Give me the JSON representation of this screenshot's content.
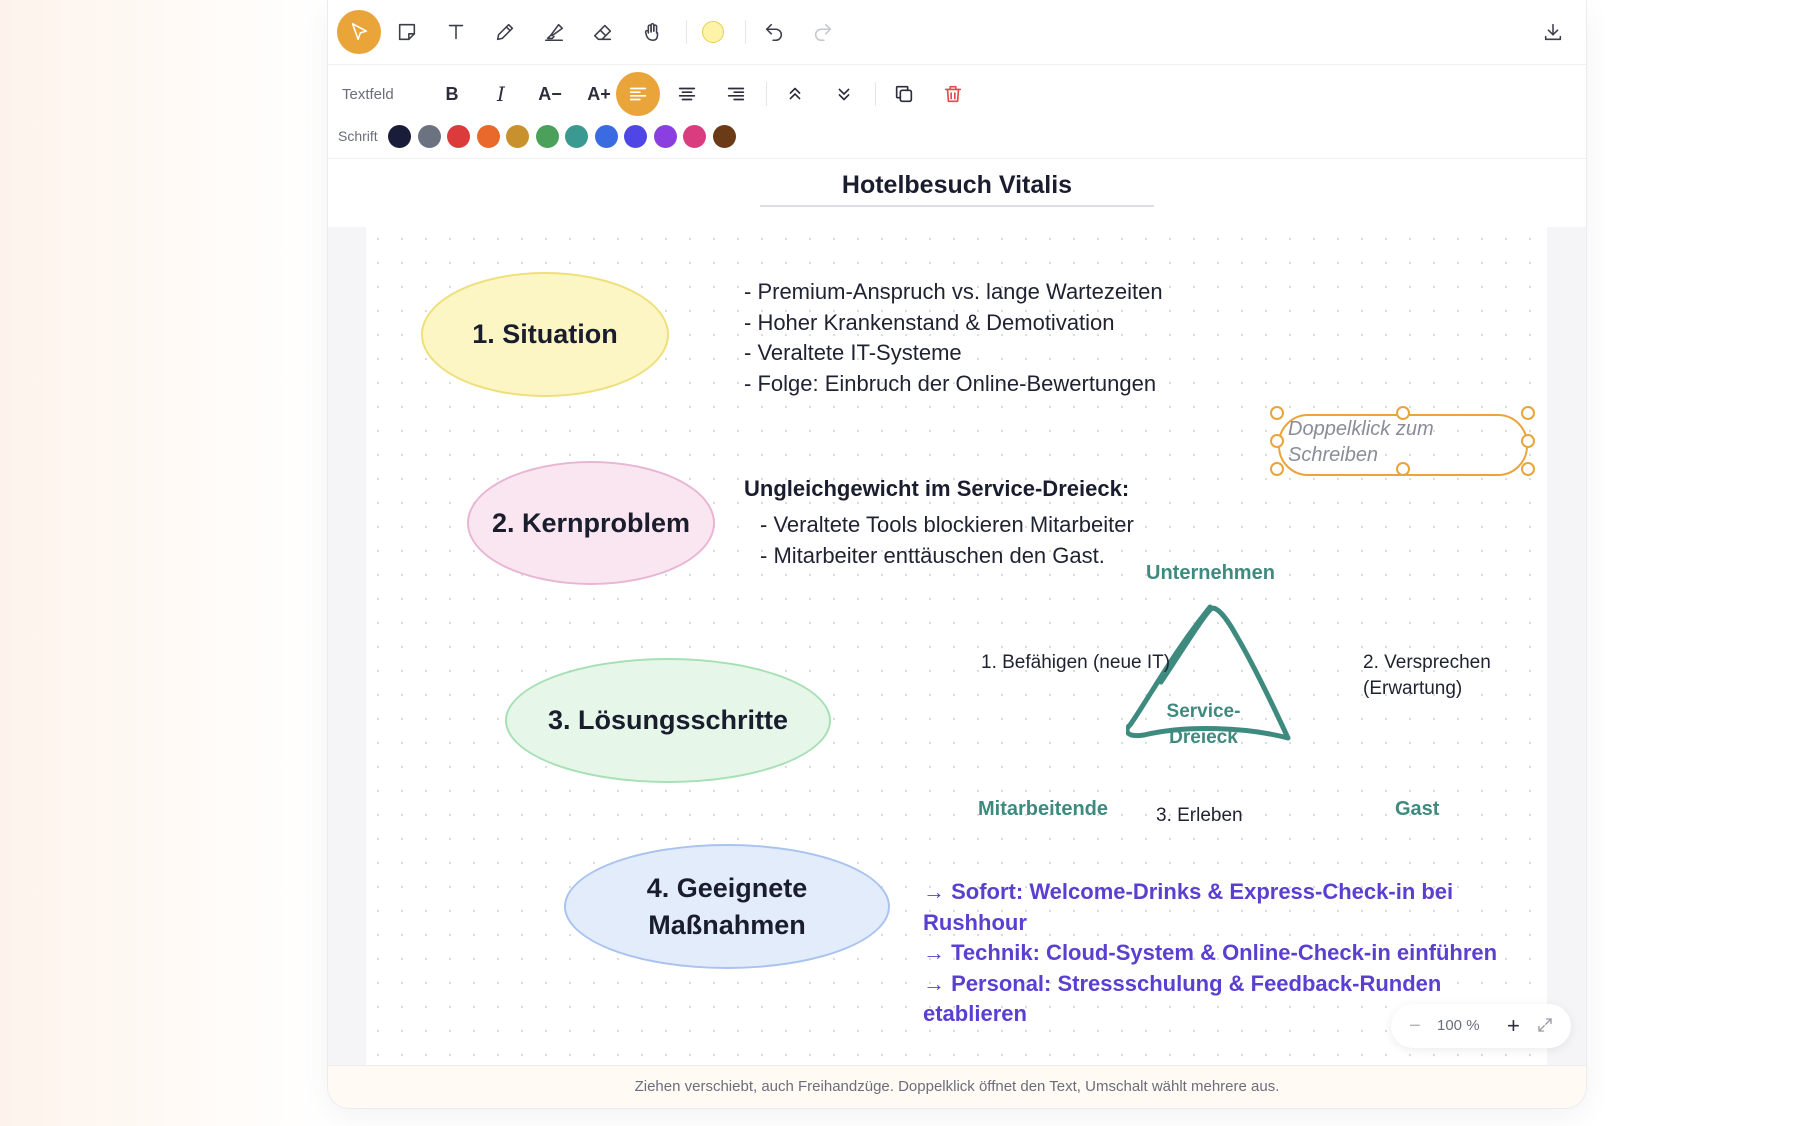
{
  "toolbar": {
    "tools": [
      {
        "name": "select-tool"
      },
      {
        "name": "sticky-note-tool"
      },
      {
        "name": "text-tool"
      },
      {
        "name": "pen-tool"
      },
      {
        "name": "highlighter-tool"
      },
      {
        "name": "eraser-tool"
      },
      {
        "name": "hand-tool"
      }
    ],
    "active_tool": "select-tool",
    "fill_color": "#fff3a8",
    "undo_enabled": true,
    "redo_enabled": false
  },
  "text_toolbar": {
    "label": "Textfeld",
    "bold": "B",
    "italic": "I",
    "size_down": "A−",
    "size_up": "A+",
    "active_align": "left"
  },
  "font_colors": {
    "label": "Schrift",
    "colors": [
      "#1a1d3a",
      "#6b7280",
      "#dc3b3b",
      "#e8692a",
      "#c9902e",
      "#4ca15a",
      "#3a9a92",
      "#3b6be0",
      "#4f46e5",
      "#8b3fe0",
      "#d93d80",
      "#6b3a16"
    ]
  },
  "document": {
    "title": "Hotelbesuch Vitalis"
  },
  "canvas": {
    "ellipses": [
      {
        "label": "1. Situation",
        "fill": "#fcf6c4",
        "stroke": "#efdf7a"
      },
      {
        "label": "2. Kernproblem",
        "fill": "#f9e6f1",
        "stroke": "#e9b5d4"
      },
      {
        "label": "3. Lösungsschritte",
        "fill": "#e6f7ea",
        "stroke": "#a6e0b4"
      },
      {
        "label_line1": "4. Geeignete",
        "label_line2": "Maßnahmen",
        "fill": "#e3ecfb",
        "stroke": "#a9c3ef"
      }
    ],
    "situation_lines": [
      "- Premium-Anspruch vs. lange Wartezeiten",
      "- Hoher Krankenstand & Demotivation",
      "- Veraltete IT-Systeme",
      "- Folge: Einbruch der Online-Bewertungen"
    ],
    "problem_heading": "Ungleichgewicht im Service-Dreieck:",
    "problem_lines": [
      "- Veraltete Tools blockieren Mitarbeiter",
      "- Mitarbeiter enttäuschen den Gast."
    ],
    "selected_text_placeholder_line1": "Doppelklick zum",
    "selected_text_placeholder_line2": "Schreiben",
    "triangle": {
      "top_label": "Unternehmen",
      "left_label": "Mitarbeitende",
      "right_label": "Gast",
      "center_line1": "Service-",
      "center_line2": "Dreieck",
      "edge_left": "1. Befähigen (neue IT)",
      "edge_right_line1": "2. Versprechen",
      "edge_right_line2": "(Erwartung)",
      "edge_bottom": "3. Erleben",
      "color": "#3f8a7e"
    },
    "measures": [
      "→ Sofort: Welcome-Drinks & Express-Check-in bei Rushhour",
      "→ Technik: Cloud-System & Online-Check-in einführen",
      "→ Personal: Stressschulung & Feedback-Runden etablieren"
    ]
  },
  "zoom": {
    "minus": "−",
    "level": "100 %",
    "plus": "+"
  },
  "status_bar": {
    "hint": "Ziehen verschiebt, auch Freihandzüge. Doppelklick öffnet den Text, Umschalt wählt mehrere aus."
  }
}
